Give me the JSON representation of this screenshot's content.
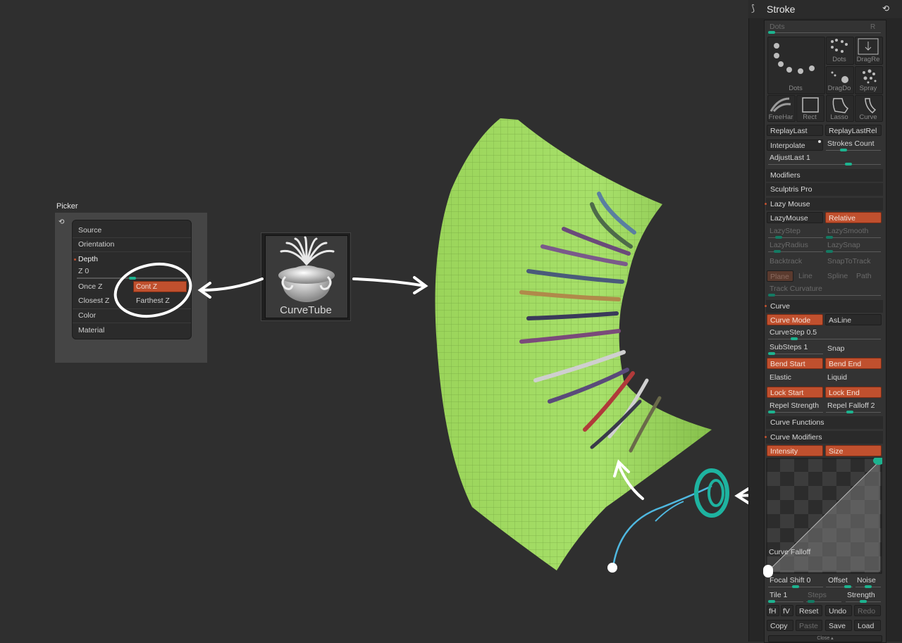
{
  "picker": {
    "tab_label": "Picker",
    "items": {
      "source": "Source",
      "orientation": "Orientation",
      "depth": "Depth",
      "z_value": "Z 0",
      "once_z": "Once Z",
      "cont_z": "Cont Z",
      "closest_z": "Closest Z",
      "farthest_z": "Farthest Z",
      "color": "Color",
      "material": "Material"
    }
  },
  "brush": {
    "label": "CurveTube"
  },
  "stroke": {
    "title": "Stroke",
    "dots_header": "Dots",
    "dots_header_suffix": "R",
    "icons": {
      "dots_big": "Dots",
      "dots": "Dots",
      "dragrect": "DragRe",
      "dragdot": "DragDo",
      "spray": "Spray",
      "freehand": "FreeHar",
      "rect": "Rect",
      "lasso": "Lasso",
      "curve": "Curve"
    },
    "replay_last": "ReplayLast",
    "replay_last_rel": "ReplayLastRel",
    "interpolate": "Interpolate",
    "strokes_count": "Strokes Count",
    "adjust_last": "AdjustLast 1",
    "modifiers": "Modifiers",
    "sculptris_pro": "Sculptris Pro",
    "lazy_mouse": {
      "title": "Lazy Mouse",
      "lazymouse": "LazyMouse",
      "relative": "Relative",
      "lazystep": "LazyStep",
      "lazysmooth": "LazySmooth",
      "lazyradius": "LazyRadius",
      "lazysnap": "LazySnap",
      "backtrack": "Backtrack",
      "snaptotrack": "SnapToTrack",
      "plane": "Plane",
      "line": "Line",
      "spline": "Spline",
      "path": "Path",
      "track_curvature": "Track Curvature"
    },
    "curve": {
      "title": "Curve",
      "curve_mode": "Curve Mode",
      "asline": "AsLine",
      "curvestep": "CurveStep 0.5",
      "substeps": "SubSteps 1",
      "snap": "Snap",
      "bend_start": "Bend Start",
      "bend_end": "Bend End",
      "elastic": "Elastic",
      "liquid": "Liquid",
      "lock_start": "Lock Start",
      "lock_end": "Lock End",
      "repel_strength": "Repel Strength",
      "repel_falloff": "Repel Falloff 2",
      "curve_functions": "Curve Functions"
    },
    "curve_modifiers": {
      "title": "Curve Modifiers",
      "intensity": "Intensity",
      "size": "Size",
      "curve_falloff": "Curve Falloff",
      "focal_shift": "Focal Shift 0",
      "offset": "Offset",
      "noise": "Noise",
      "tile": "Tile 1",
      "steps": "Steps",
      "strength": "Strength",
      "fh": "fH",
      "fv": "fV",
      "reset": "Reset",
      "undo": "Undo",
      "redo": "Redo",
      "copy": "Copy",
      "paste": "Paste",
      "save": "Save",
      "load": "Load",
      "close": "Close"
    }
  },
  "colors": {
    "accent_orange": "#c0502e",
    "slider_teal": "#1db38f",
    "mesh_green": "#9fdc5c",
    "background": "#2f2f2f"
  }
}
